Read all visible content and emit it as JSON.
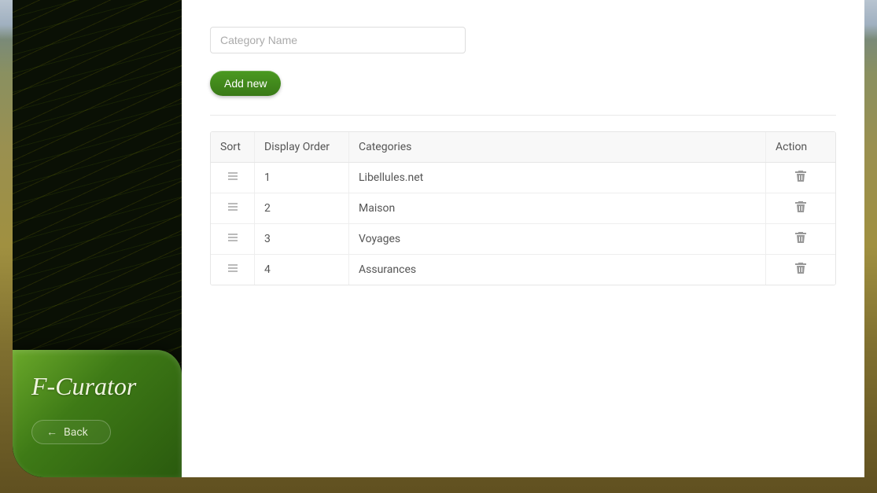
{
  "sidebar": {
    "brand": "F-Curator",
    "back_label": "Back"
  },
  "form": {
    "category_input_placeholder": "Category Name",
    "add_button_label": "Add new"
  },
  "table": {
    "headers": {
      "sort": "Sort",
      "display_order": "Display Order",
      "categories": "Categories",
      "action": "Action"
    },
    "rows": [
      {
        "order": "1",
        "name": "Libellules.net"
      },
      {
        "order": "2",
        "name": "Maison"
      },
      {
        "order": "3",
        "name": "Voyages"
      },
      {
        "order": "4",
        "name": "Assurances"
      }
    ]
  }
}
